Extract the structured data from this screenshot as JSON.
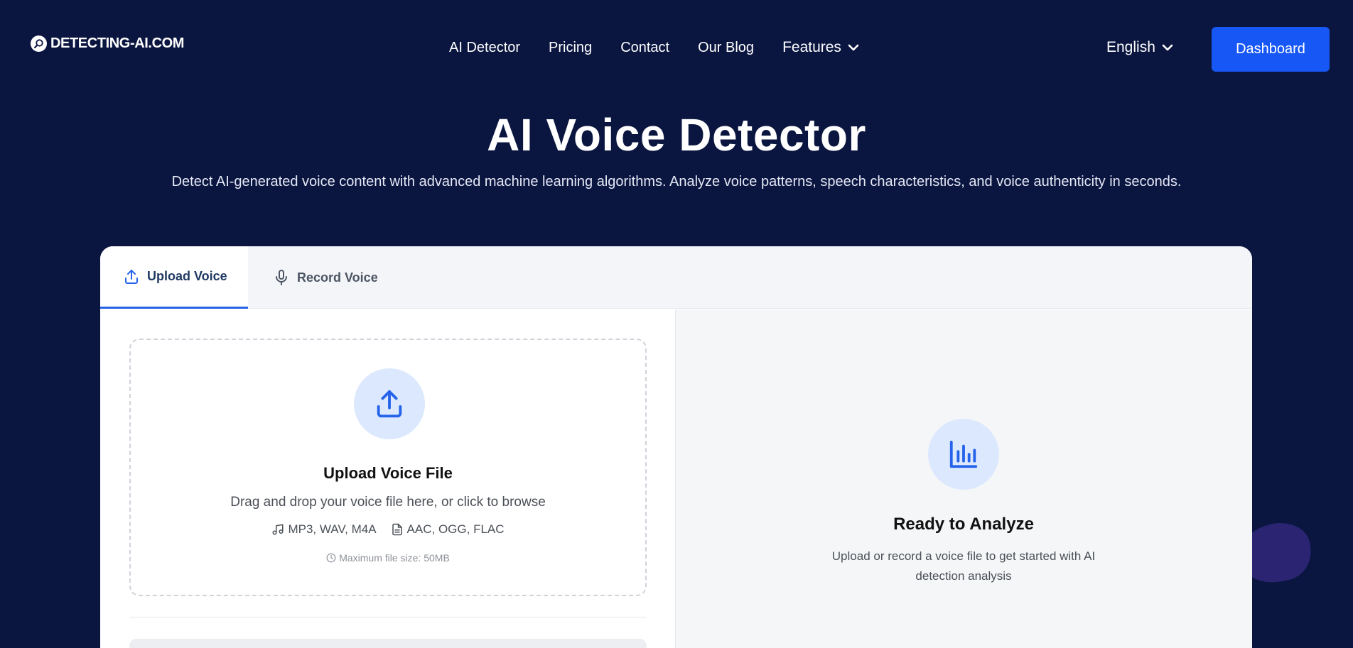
{
  "header": {
    "logo_text": "DETECTING-AI.COM",
    "nav": [
      {
        "label": "AI Detector"
      },
      {
        "label": "Pricing"
      },
      {
        "label": "Contact"
      },
      {
        "label": "Our Blog"
      }
    ],
    "features_label": "Features",
    "language": "English",
    "dashboard_label": "Dashboard"
  },
  "hero": {
    "title": "AI Voice Detector",
    "subtitle": "Detect AI-generated voice content with advanced machine learning algorithms. Analyze voice patterns, speech characteristics, and voice authenticity in seconds."
  },
  "tabs": [
    {
      "label": "Upload Voice",
      "icon": "upload-icon",
      "active": true
    },
    {
      "label": "Record Voice",
      "icon": "microphone-icon",
      "active": false
    }
  ],
  "upload": {
    "title": "Upload Voice File",
    "description": "Drag and drop your voice file here, or click to browse",
    "formats": [
      {
        "label": "MP3, WAV, M4A",
        "icon": "music-note-icon"
      },
      {
        "label": "AAC, OGG, FLAC",
        "icon": "file-icon"
      }
    ],
    "max_size": "Maximum file size: 50MB"
  },
  "analysis": {
    "title": "Ready to Analyze",
    "description": "Upload or record a voice file to get started with AI detection analysis"
  },
  "colors": {
    "background": "#0b1640",
    "accent": "#1757f5",
    "icon_blue": "#2563eb",
    "icon_circle": "#dce8fd"
  }
}
